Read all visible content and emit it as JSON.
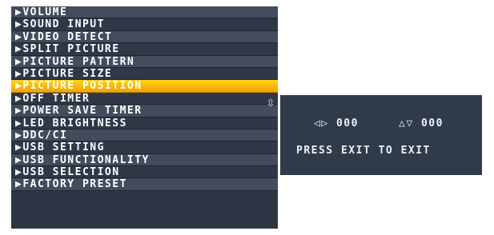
{
  "menu": {
    "items": [
      {
        "label": "▶VOLUME"
      },
      {
        "label": "▶SOUND INPUT"
      },
      {
        "label": "▶VIDEO DETECT"
      },
      {
        "label": "▶SPLIT PICTURE"
      },
      {
        "label": "▶PICTURE PATTERN"
      },
      {
        "label": "▶PICTURE SIZE"
      },
      {
        "label": "▶PICTURE POSITION",
        "selected": true
      },
      {
        "label": "▶OFF TIMER"
      },
      {
        "label": "▶POWER SAVE TIMER"
      },
      {
        "label": "▶LED BRIGHTNESS"
      },
      {
        "label": "▶DDC/CI"
      },
      {
        "label": "▶USB SETTING"
      },
      {
        "label": "▶USB FUNCTIONALITY"
      },
      {
        "label": "▶USB SELECTION"
      },
      {
        "label": "▶FACTORY PRESET"
      }
    ]
  },
  "submenu": {
    "arrow_glyph": "⇳",
    "h_position": "◁▷ 000",
    "v_position": "△▽ 000",
    "exit_hint": "PRESS EXIT TO EXIT"
  },
  "colors": {
    "menu_background": "#2c3644",
    "selected_highlight": "#f3a400",
    "submenu_background": "#2f3a4a",
    "text": "#ffffff"
  }
}
